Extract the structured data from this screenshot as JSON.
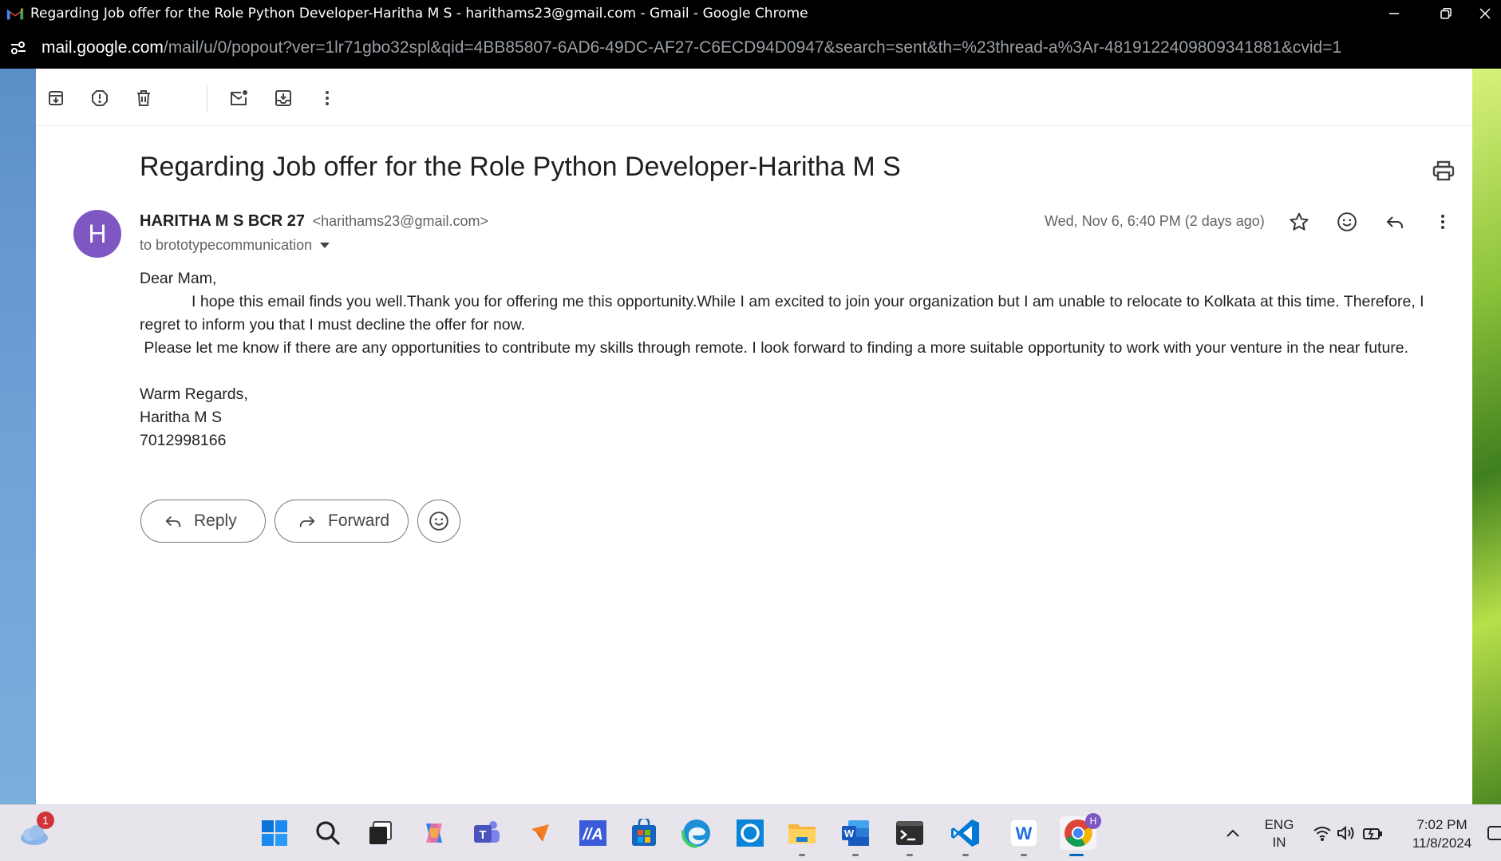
{
  "window": {
    "title": "Regarding Job offer for the Role Python Developer-Haritha M S - harithams23@gmail.com - Gmail - Google Chrome"
  },
  "urlbar": {
    "domain": "mail.google.com",
    "path": "/mail/u/0/popout?ver=1lr71gbo32spl&qid=4BB85807-6AD6-49DC-AF27-C6ECD94D0947&search=sent&th=%23thread-a%3Ar-4819122409809341881&cvid=1"
  },
  "email": {
    "subject": "Regarding Job offer for the Role Python Developer-Haritha M S",
    "avatar_letter": "H",
    "sender_name": "HARITHA M S BCR 27",
    "sender_email": "<harithams23@gmail.com>",
    "recipient": "to brototypecommunication",
    "date": "Wed, Nov 6, 6:40 PM (2 days ago)",
    "body": [
      "Dear Mam,",
      "            I hope this email finds you well.Thank you for offering me this opportunity.While I am excited to join your organization but I am unable to relocate to Kolkata at this time. Therefore, I regret to inform you that I must decline the offer for now.",
      " Please let me know if there are any opportunities to contribute my skills through remote. I look forward to finding a more suitable opportunity to work with your venture in the near future.",
      "",
      "Warm Regards,",
      "Haritha M S",
      "7012998166"
    ]
  },
  "actions": {
    "reply": "Reply",
    "forward": "Forward"
  },
  "taskbar": {
    "weather_badge": "1",
    "chrome_profile": "H",
    "lang_line1": "ENG",
    "lang_line2": "IN",
    "time": "7:02 PM",
    "date": "11/8/2024"
  }
}
